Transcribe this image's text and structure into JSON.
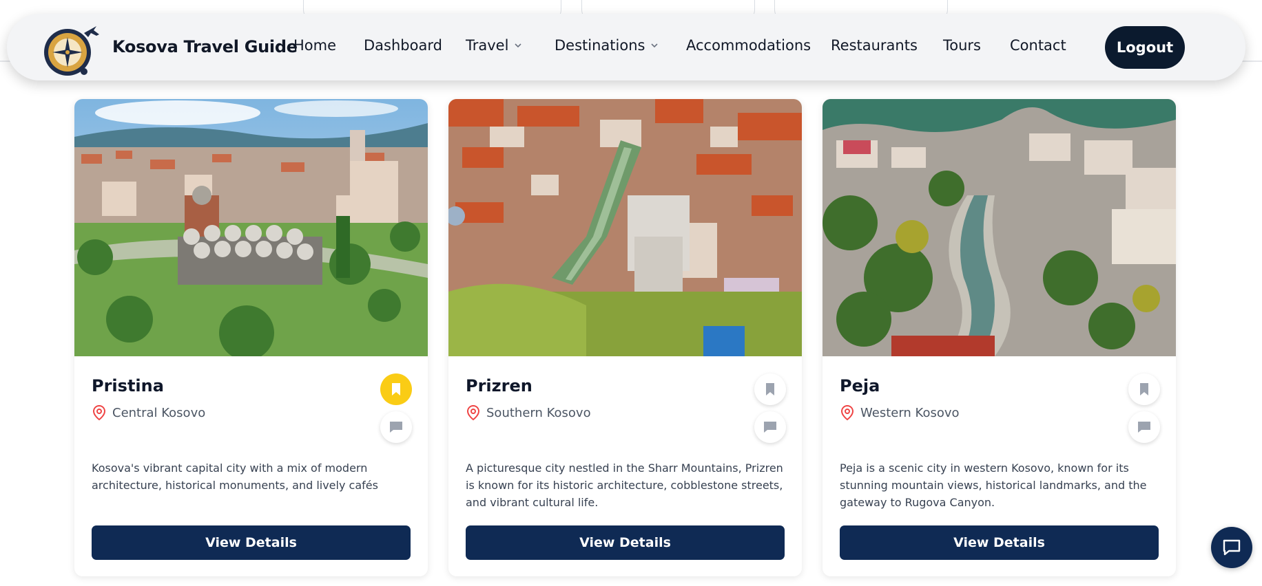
{
  "brand": {
    "name": "Kosova Travel Guide",
    "logo_icon": "compass-airplane-logo"
  },
  "nav": {
    "items": [
      {
        "label": "Home",
        "has_dropdown": false
      },
      {
        "label": "Dashboard",
        "has_dropdown": false
      },
      {
        "label": "Travel",
        "has_dropdown": true
      },
      {
        "label": "Destinations",
        "has_dropdown": true
      },
      {
        "label": "Accommodations",
        "has_dropdown": false
      },
      {
        "label": "Restaurants",
        "has_dropdown": false
      },
      {
        "label": "Tours",
        "has_dropdown": false
      },
      {
        "label": "Contact",
        "has_dropdown": false
      }
    ],
    "logout_label": "Logout"
  },
  "cards": [
    {
      "title": "Pristina",
      "location": "Central Kosovo",
      "description": "Kosova's vibrant capital city with a mix of modern architecture, historical monuments, and lively cafés",
      "button_label": "View Details",
      "bookmarked": true,
      "image_scene": "city-panorama-with-library-and-church"
    },
    {
      "title": "Prizren",
      "location": "Southern Kosovo",
      "description": "A picturesque city nestled in the Sharr Mountains, Prizren is known for its historic architecture, cobblestone streets, and vibrant cultural life.",
      "button_label": "View Details",
      "bookmarked": false,
      "image_scene": "old-town-rooftops-with-river"
    },
    {
      "title": "Peja",
      "location": "Western Kosovo",
      "description": "Peja is a scenic city in western Kosovo, known for its stunning mountain views, historical landmarks, and the gateway to Rugova Canyon.",
      "button_label": "View Details",
      "bookmarked": false,
      "image_scene": "river-valley-town-with-mountains"
    }
  ],
  "colors": {
    "primary": "#0f2a54",
    "logout_bg": "#0b1a2e",
    "bookmark_active": "#facc15",
    "pin": "#ef4444",
    "icon_gray": "#9ca3af"
  }
}
